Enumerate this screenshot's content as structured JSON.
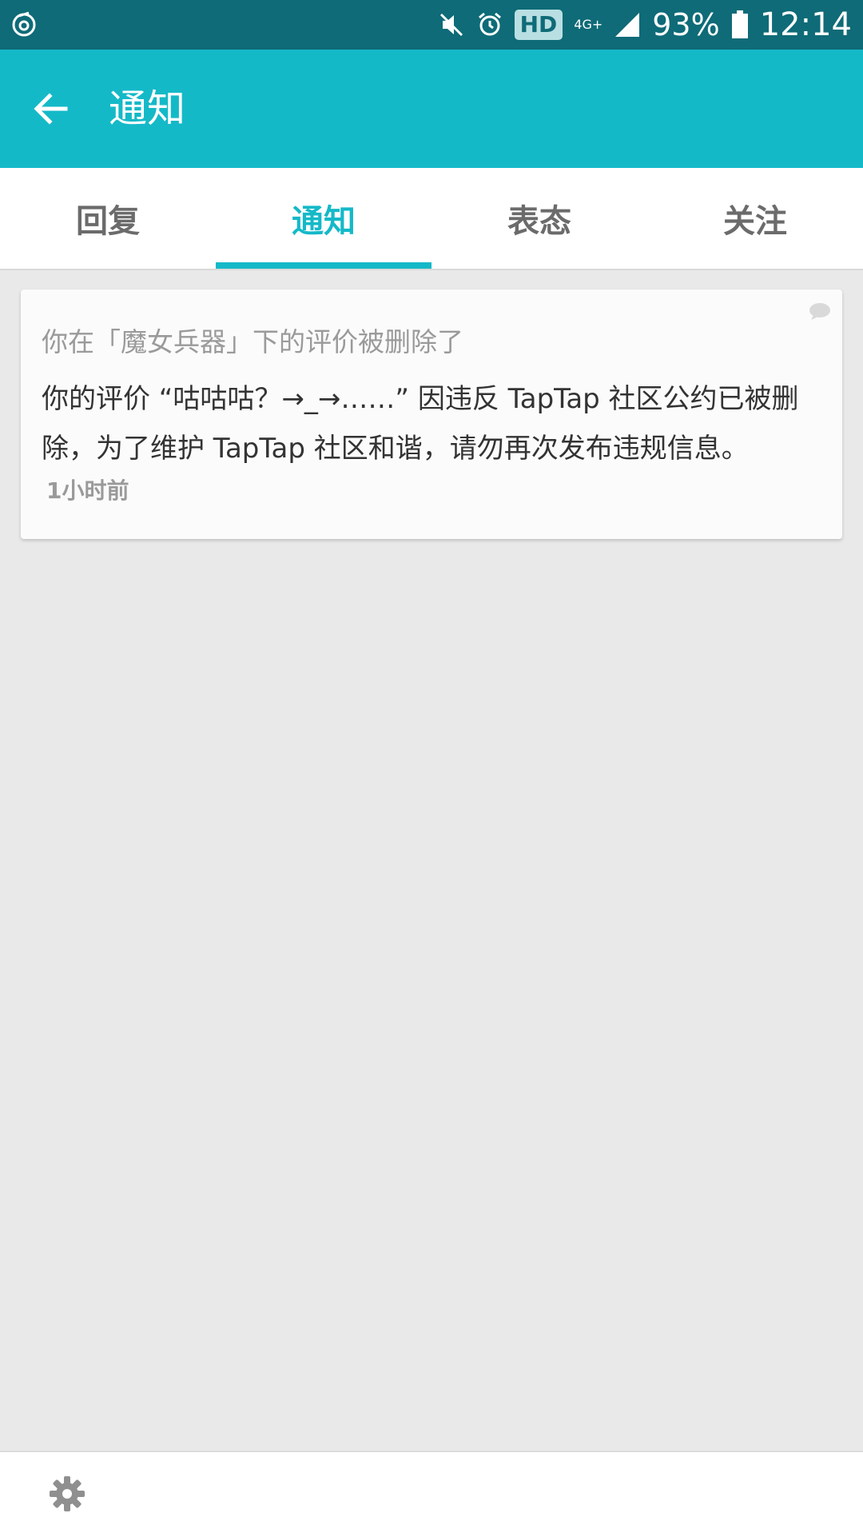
{
  "statusbar": {
    "network_label": "4G+",
    "hd_label": "HD",
    "battery": "93%",
    "time": "12:14"
  },
  "appbar": {
    "title": "通知"
  },
  "tabs": [
    {
      "label": "回复"
    },
    {
      "label": "通知"
    },
    {
      "label": "表态"
    },
    {
      "label": "关注"
    }
  ],
  "notification": {
    "subtitle": "你在「魔女兵器」下的评价被删除了",
    "body": "你的评价 “咕咕咕？→_→……” 因违反 TapTap 社区公约已被删除，为了维护 TapTap 社区和谐，请勿再次发布违规信息。",
    "time": "1小时前"
  },
  "colors": {
    "statusbar": "#0e6b77",
    "accent": "#14b9c8",
    "background": "#e9e9e9"
  },
  "icons": {
    "back": "arrow-left-icon",
    "settings": "gear-icon"
  }
}
